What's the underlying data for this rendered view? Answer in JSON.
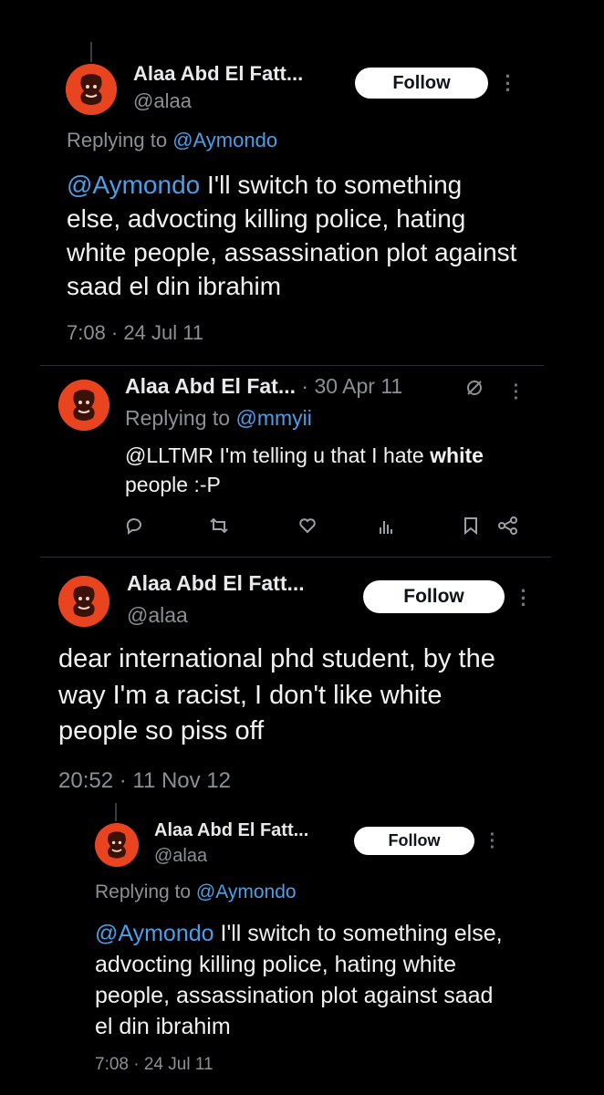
{
  "tweet1": {
    "name": "Alaa Abd El Fatt...",
    "handle": "@alaa",
    "follow_label": "Follow",
    "replying_prefix": "Replying to ",
    "replying_to": "@Aymondo",
    "mention": "@Aymondo",
    "body": " I'll switch to something else, advocting killing police, hating white people, assassination plot against saad el din ibrahim",
    "timestamp": "7:08 · 24 Jul 11"
  },
  "tweet2": {
    "name": "Alaa Abd El Fat...",
    "date": " · 30 Apr 11",
    "replying_prefix": "Replying to ",
    "replying_to": "@mmyii",
    "body_start": "@LLTMR I'm telling u that I hate ",
    "body_bold": "white",
    "body_end": " people :-P"
  },
  "tweet3": {
    "name": "Alaa Abd El Fatt...",
    "handle": "@alaa",
    "follow_label": "Follow",
    "body": "dear international phd student, by the way I'm a racist, I don't like white people so piss off",
    "timestamp": "20:52 · 11 Nov 12"
  },
  "tweet4": {
    "name": "Alaa Abd El Fatt...",
    "handle": "@alaa",
    "follow_label": "Follow",
    "replying_prefix": "Replying to ",
    "replying_to": "@Aymondo",
    "mention": "@Aymondo",
    "body": " I'll switch to something else, advocting killing police, hating white people, assassination plot against saad el din ibrahim",
    "timestamp": "7:08 · 24 Jul 11"
  },
  "icons": {
    "more": "more-icon",
    "reply": "reply-icon",
    "retweet": "retweet-icon",
    "like": "like-icon",
    "views": "views-icon",
    "bookmark": "bookmark-icon",
    "share": "share-icon",
    "grok": "grok-icon"
  },
  "colors": {
    "background": "#000000",
    "link": "#4a9fe8",
    "avatar": "#e8441f",
    "muted": "#8b9095"
  }
}
